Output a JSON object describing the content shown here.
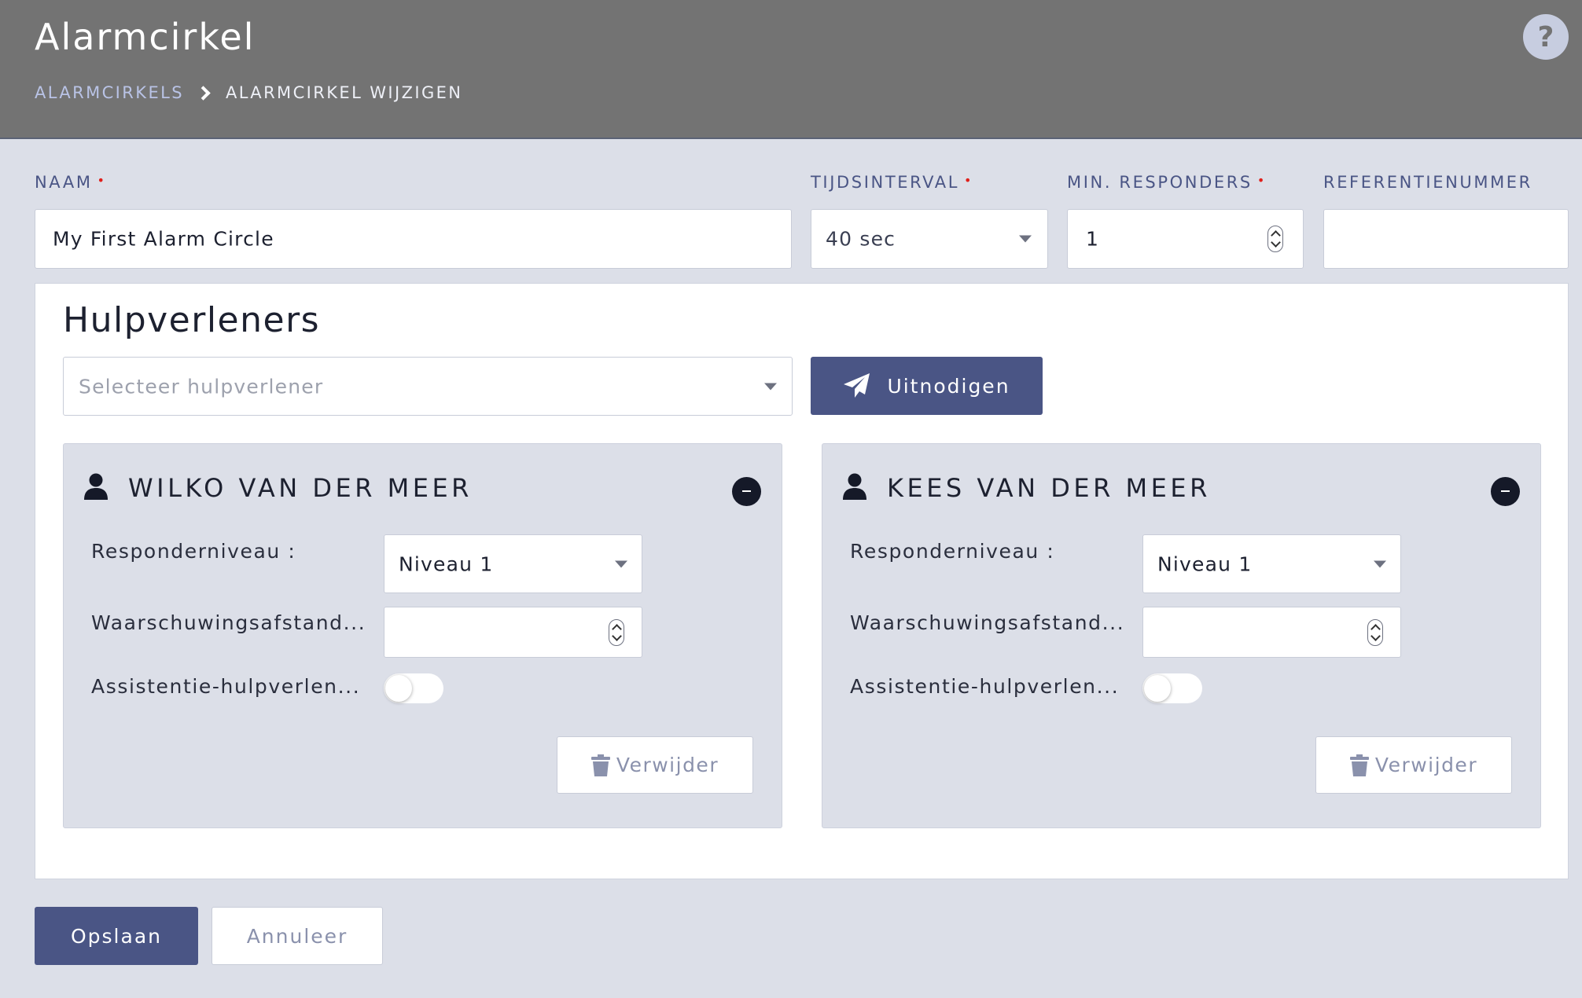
{
  "header": {
    "title": "Alarmcirkel",
    "breadcrumb": {
      "parent": "ALARMCIRKELS",
      "current": "ALARMCIRKEL WIJZIGEN"
    },
    "help_icon": "?"
  },
  "form": {
    "name": {
      "label": "NAAM",
      "required_marker": "•",
      "value": "My First Alarm Circle"
    },
    "interval": {
      "label": "TIJDSINTERVAL",
      "required_marker": "•",
      "value": "40 sec"
    },
    "min_responders": {
      "label": "MIN. RESPONDERS",
      "required_marker": "•",
      "value": "1"
    },
    "reference": {
      "label": "REFERENTIENUMMER",
      "value": ""
    }
  },
  "responders_section": {
    "title": "Hulpverleners",
    "select_placeholder": "Selecteer hulpverlener",
    "invite_label": "Uitnodigen",
    "cards": [
      {
        "name": "WILKO VAN DER MEER",
        "level_label": "Responderniveau :",
        "level_value": "Niveau 1",
        "distance_label": "Waarschuwingsafstand...",
        "distance_value": "",
        "assist_label": "Assistentie-hulpverlen...",
        "assist_enabled": false,
        "delete_label": "Verwijder"
      },
      {
        "name": "KEES VAN DER MEER",
        "level_label": "Responderniveau :",
        "level_value": "Niveau 1",
        "distance_label": "Waarschuwingsafstand...",
        "distance_value": "",
        "assist_label": "Assistentie-hulpverlen...",
        "assist_enabled": false,
        "delete_label": "Verwijder"
      }
    ]
  },
  "actions": {
    "save_label": "Opslaan",
    "cancel_label": "Annuleer"
  },
  "colors": {
    "header_bg": "#737373",
    "primary": "#4a5585",
    "page_bg": "#dcdfe8",
    "required": "#e0201b"
  }
}
